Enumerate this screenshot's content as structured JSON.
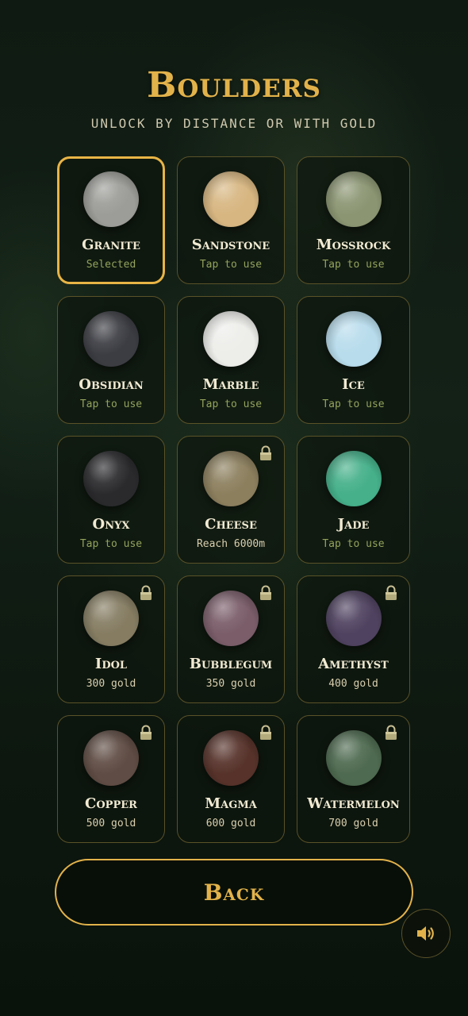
{
  "title": "Boulders",
  "subtitle": "UNLOCK BY DISTANCE OR WITH GOLD",
  "boulders": [
    {
      "name": "Granite",
      "status": "Selected",
      "locked": false,
      "selected": true,
      "color": "#9c9c98"
    },
    {
      "name": "Sandstone",
      "status": "Tap to use",
      "locked": false,
      "selected": false,
      "color": "#d7b681"
    },
    {
      "name": "Mossrock",
      "status": "Tap to use",
      "locked": false,
      "selected": false,
      "color": "#8b9572"
    },
    {
      "name": "Obsidian",
      "status": "Tap to use",
      "locked": false,
      "selected": false,
      "color": "#3c3d43"
    },
    {
      "name": "Marble",
      "status": "Tap to use",
      "locked": false,
      "selected": false,
      "color": "#ededea"
    },
    {
      "name": "Ice",
      "status": "Tap to use",
      "locked": false,
      "selected": false,
      "color": "#b8dcec"
    },
    {
      "name": "Onyx",
      "status": "Tap to use",
      "locked": false,
      "selected": false,
      "color": "#2a2a2d"
    },
    {
      "name": "Cheese",
      "status": "Reach 6000m",
      "locked": true,
      "selected": false,
      "color": "#8c7f5e"
    },
    {
      "name": "Jade",
      "status": "Tap to use",
      "locked": false,
      "selected": false,
      "color": "#45b08a"
    },
    {
      "name": "Idol",
      "status": "300 gold",
      "locked": true,
      "selected": false,
      "color": "#857c62"
    },
    {
      "name": "Bubblegum",
      "status": "350 gold",
      "locked": true,
      "selected": false,
      "color": "#7a5d69"
    },
    {
      "name": "Amethyst",
      "status": "400 gold",
      "locked": true,
      "selected": false,
      "color": "#4f4260"
    },
    {
      "name": "Copper",
      "status": "500 gold",
      "locked": true,
      "selected": false,
      "color": "#5f4c44"
    },
    {
      "name": "Magma",
      "status": "600 gold",
      "locked": true,
      "selected": false,
      "color": "#56322a"
    },
    {
      "name": "Watermelon",
      "status": "700 gold",
      "locked": true,
      "selected": false,
      "color": "#4e6a50"
    }
  ],
  "back_label": "Back",
  "icons": {
    "lock": "lock-icon",
    "sound": "speaker-icon"
  },
  "colors": {
    "accent": "#e2b24a",
    "card_border": "#5a5228",
    "status_unlocked": "#93a35c",
    "status_locked": "#d9cfae"
  }
}
